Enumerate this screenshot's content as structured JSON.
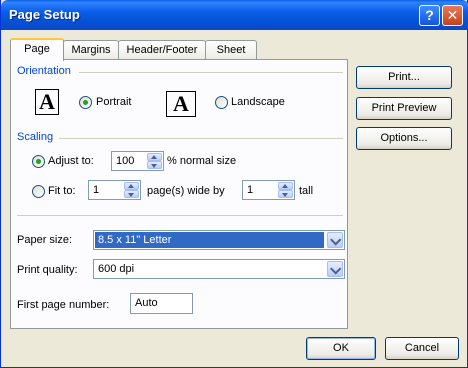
{
  "window": {
    "title": "Page Setup",
    "help_glyph": "?",
    "close_glyph": "✕"
  },
  "tabs": [
    {
      "label": "Page"
    },
    {
      "label": "Margins"
    },
    {
      "label": "Header/Footer"
    },
    {
      "label": "Sheet"
    }
  ],
  "orientation": {
    "group_label": "Orientation",
    "portrait_icon": "A",
    "portrait_label": "Portrait",
    "landscape_icon": "A",
    "landscape_label": "Landscape",
    "selected": "portrait"
  },
  "scaling": {
    "group_label": "Scaling",
    "adjust_label": "Adjust to:",
    "adjust_value": "100",
    "adjust_suffix": "% normal size",
    "fit_label": "Fit to:",
    "fit_wide_value": "1",
    "fit_wide_suffix": "page(s) wide by",
    "fit_tall_value": "1",
    "fit_tall_suffix": "tall",
    "selected": "adjust"
  },
  "paper": {
    "paper_size_label": "Paper size:",
    "paper_size_value": "8.5 x 11\" Letter",
    "print_quality_label": "Print quality:",
    "print_quality_value": "600 dpi",
    "first_page_label": "First page number:",
    "first_page_value": "Auto"
  },
  "side_buttons": {
    "print": "Print...",
    "print_preview": "Print Preview",
    "options": "Options..."
  },
  "footer": {
    "ok": "OK",
    "cancel": "Cancel"
  }
}
